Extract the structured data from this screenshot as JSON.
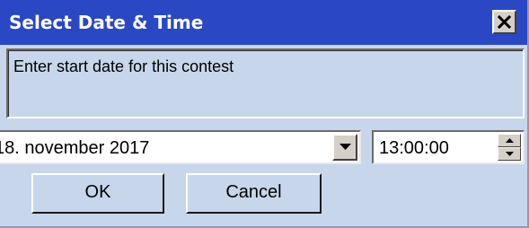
{
  "window": {
    "title": "Select Date & Time",
    "close_icon": "close-icon",
    "colors": {
      "titlebar": "#2a47c4",
      "background": "#c7d6ea"
    }
  },
  "message": {
    "text": "Enter start date for this contest"
  },
  "date_picker": {
    "value": "18. november 2017",
    "dropdown_icon": "chevron-down-icon"
  },
  "time_picker": {
    "value": "13:00:00",
    "spinner_up_icon": "arrow-up-icon",
    "spinner_down_icon": "arrow-down-icon"
  },
  "buttons": {
    "ok_label": "OK",
    "cancel_label": "Cancel"
  }
}
